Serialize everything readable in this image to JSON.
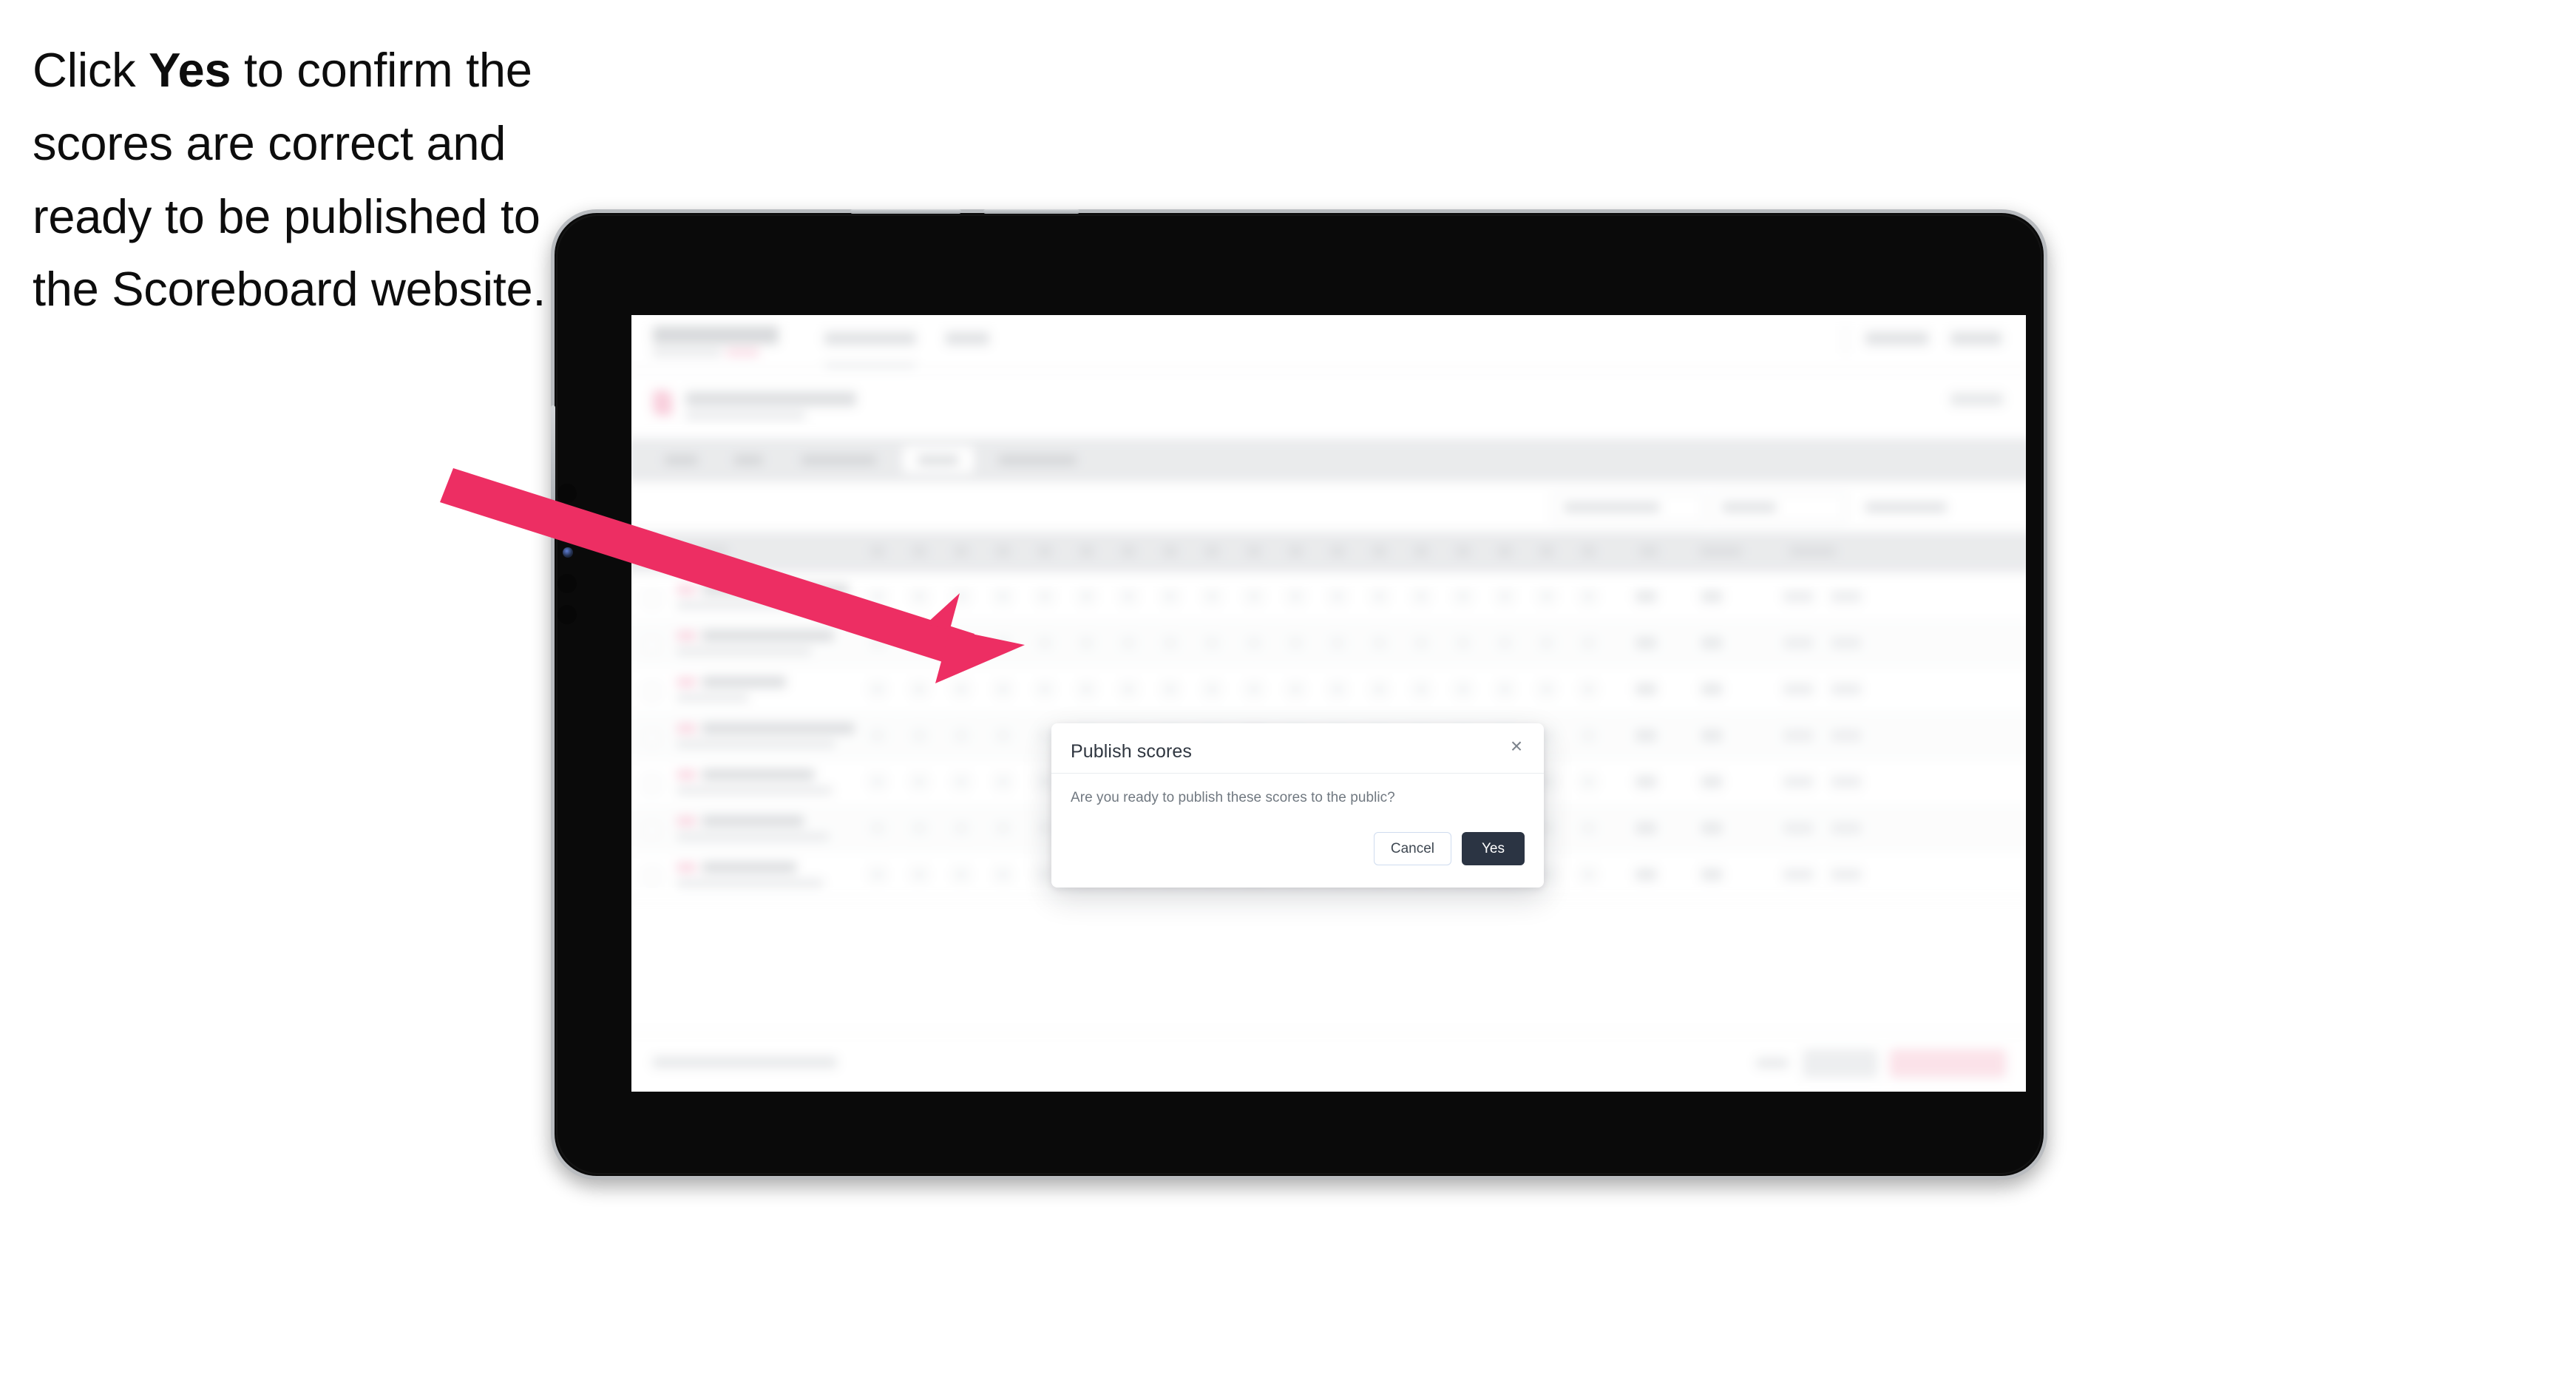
{
  "instruction": {
    "before": "Click ",
    "emphasis": "Yes",
    "after": " to confirm the scores are correct and ready to be published to the Scoreboard website."
  },
  "annotation": {
    "arrow_color": "#ed2e63",
    "arrow_name": "pointer-arrow"
  },
  "device": {
    "type": "tablet",
    "body_color": "#0a0a0a",
    "bezel_color": "#b9bcc0"
  },
  "modal": {
    "title": "Publish scores",
    "body": "Are you ready to publish these scores to the public?",
    "close_icon": "close-icon",
    "close_glyph": "×",
    "cancel_label": "Cancel",
    "yes_label": "Yes",
    "yes_color": "#2b3443",
    "cancel_border_color": "#cfdcef"
  },
  "background_app": {
    "blurred": true,
    "note": "Application behind the modal is rendered out of focus; text is not legible.",
    "navbar": {
      "links": 2,
      "right_links": 2
    },
    "tabs": {
      "count": 5,
      "active_index": 3
    },
    "toolbar": {
      "controls": 3
    },
    "table": {
      "header_cells": 20,
      "rows": 7,
      "score_columns": 16,
      "summary_columns": 2,
      "wide_columns": 2
    },
    "footer": {
      "buttons": 2,
      "link": 1,
      "primary_button_color": "#f9ccd8"
    }
  }
}
